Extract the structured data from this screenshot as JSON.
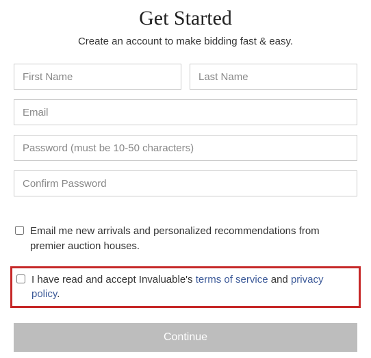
{
  "heading": "Get Started",
  "subheading": "Create an account to make bidding fast & easy.",
  "fields": {
    "first_name_placeholder": "First Name",
    "last_name_placeholder": "Last Name",
    "email_placeholder": "Email",
    "password_placeholder": "Password (must be 10-50 characters)",
    "confirm_password_placeholder": "Confirm Password"
  },
  "checkboxes": {
    "newsletter_label": "Email me new arrivals and personalized recommendations from premier auction houses.",
    "terms_prefix": "I have read and accept Invaluable's ",
    "terms_link": "terms of service",
    "terms_middle": " and ",
    "privacy_link": "privacy policy",
    "terms_suffix": "."
  },
  "continue_label": "Continue"
}
